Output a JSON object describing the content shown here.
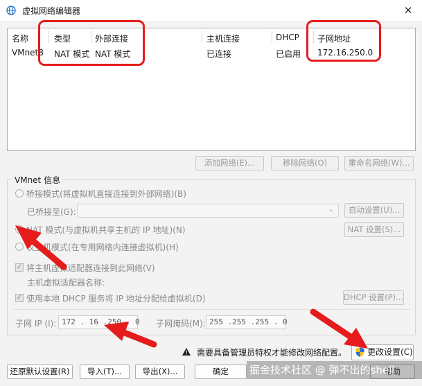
{
  "window": {
    "title": "虚拟网络编辑器",
    "close_glyph": "✕"
  },
  "table": {
    "headers": [
      "名称",
      "类型",
      "外部连接",
      "主机连接",
      "DHCP",
      "子网地址"
    ],
    "rows": [
      [
        "VMnet8",
        "NAT 模式",
        "NAT 模式",
        "已连接",
        "已启用",
        "172.16.250.0"
      ]
    ]
  },
  "list_buttons": {
    "add": "添加网络(E)...",
    "remove": "移除网络(O)",
    "rename": "重命名网络(W)..."
  },
  "vmnet_info": {
    "group_label": "VMnet 信息",
    "bridged_label": "桥接模式(将虚拟机直接连接到外部网络)(B)",
    "bridged_to_label": "已桥接至(G):",
    "bridged_to_value": "",
    "auto_settings": "自动设置(U)...",
    "nat_label": "NAT 模式(与虚拟机共享主机的 IP 地址)(N)",
    "nat_settings": "NAT 设置(S)...",
    "hostonly_label": "仅主机模式(在专用网络内连接虚拟机)(H)",
    "connect_adapter_label": "将主机虚拟适配器连接到此网络(V)",
    "adapter_name_label": "主机虚拟适配器名称:",
    "dhcp_label": "使用本地 DHCP 服务将 IP 地址分配给虚拟机(D)",
    "dhcp_settings": "DHCP 设置(P)...",
    "subnet_ip_label": "子网 IP (I):",
    "subnet_ip_value": "172 . 16 .250 . 0",
    "subnet_mask_label": "子网掩码(M):",
    "subnet_mask_value": "255 .255 .255 . 0",
    "selected_mode": "nat"
  },
  "admin_warning": "需要具备管理员特权才能修改网络配置。",
  "change_settings_button": "更改设置(C)",
  "bottom_buttons": {
    "restore": "还原默认设置(R)",
    "import": "导入(T)...",
    "export": "导出(X)...",
    "ok": "确定",
    "help": "帮助"
  },
  "watermark": "掘金技术社区 @ 弹不出的shell",
  "colors": {
    "annotation_red": "#e61b1b",
    "window_bg": "#f3f3f3"
  }
}
